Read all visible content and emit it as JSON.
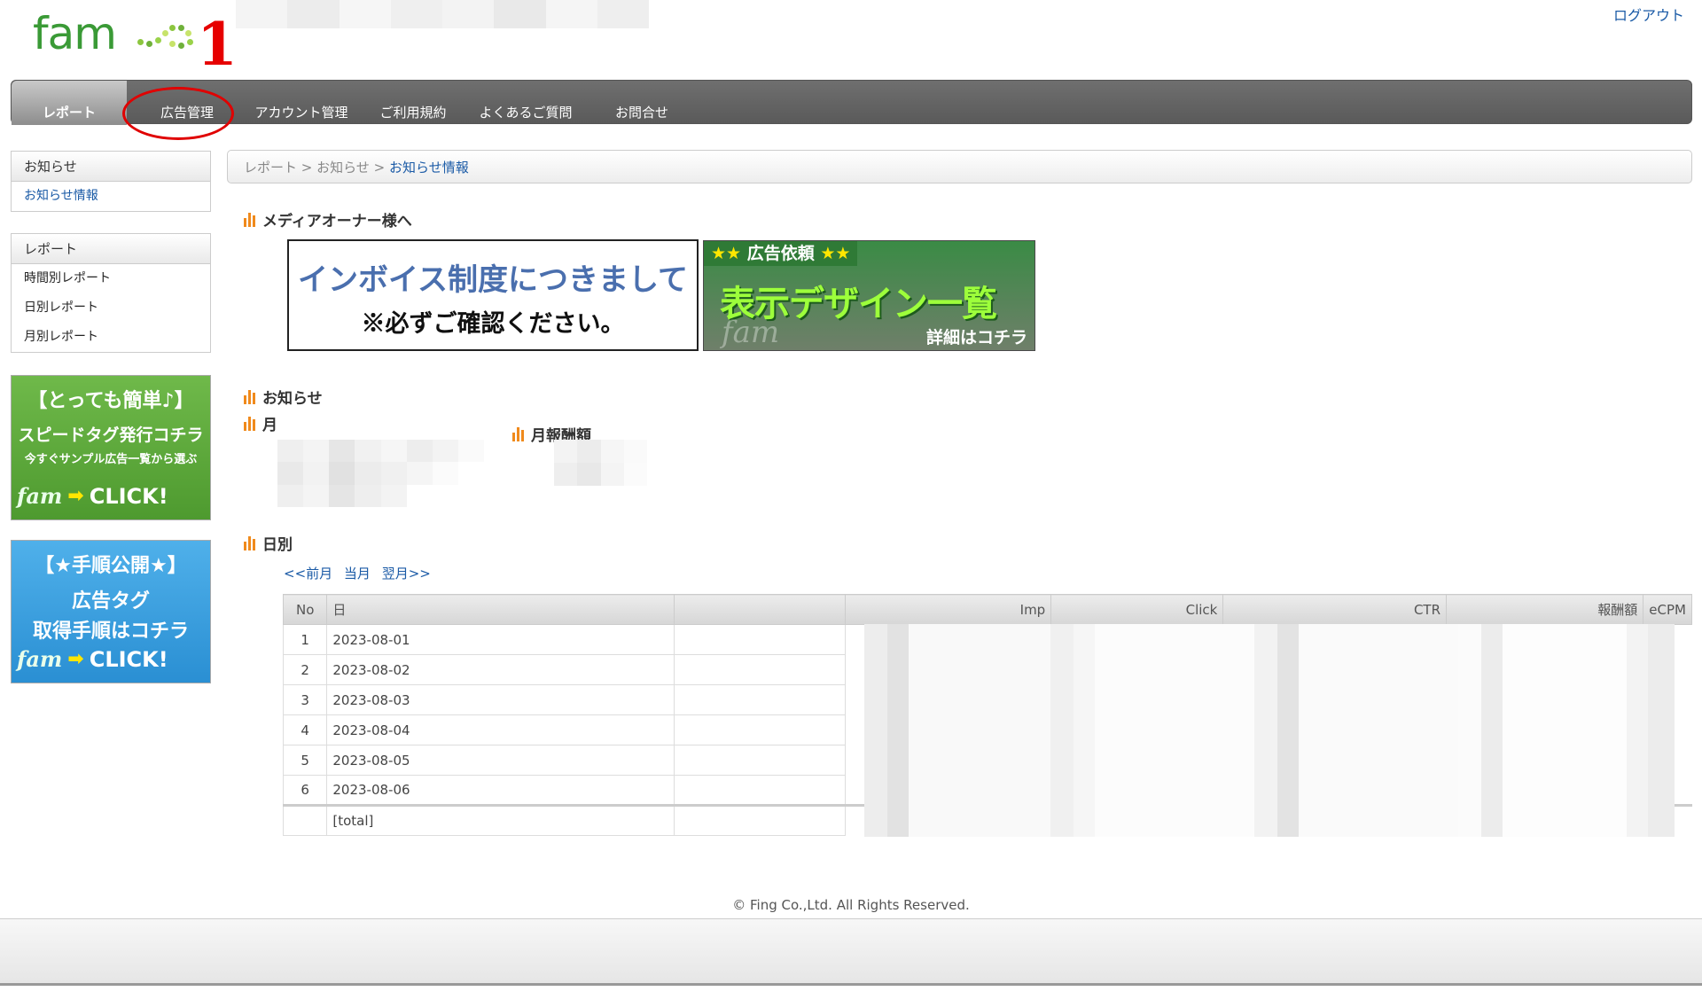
{
  "header": {
    "logo_text": "fam",
    "annotation_number": "1",
    "logout_label": "ログアウト"
  },
  "nav": {
    "items": [
      {
        "label": "レポート",
        "active": true
      },
      {
        "label": "広告管理",
        "active": false
      },
      {
        "label": "アカウント管理",
        "active": false
      },
      {
        "label": "ご利用規約",
        "active": false
      },
      {
        "label": "よくあるご質問",
        "active": false
      },
      {
        "label": "お問合せ",
        "active": false
      }
    ]
  },
  "sidebar": {
    "notice_box": {
      "title": "お知らせ",
      "items": [
        "お知らせ情報"
      ]
    },
    "report_box": {
      "title": "レポート",
      "items": [
        "時間別レポート",
        "日別レポート",
        "月別レポート"
      ]
    },
    "banner_speed": {
      "line1": "【とっても簡単♪】",
      "line2": "スピードタグ発行コチラ",
      "line3": "今すぐサンプル広告一覧から選ぶ",
      "brand": "fam",
      "click": "CLICK!"
    },
    "banner_steps": {
      "line1": "【★手順公開★】",
      "line2": "広告タグ",
      "line3": "取得手順はコチラ",
      "brand": "fam",
      "click": "CLICK!"
    }
  },
  "breadcrumb": {
    "item1": "レポート",
    "item2": "お知らせ",
    "current": "お知らせ情報",
    "sep": ">"
  },
  "sections": {
    "media_owner": "メディアオーナー様へ",
    "notice": "お知らせ",
    "month": "月",
    "monthly_reward": "月報酬額",
    "daily": "日別"
  },
  "banners": {
    "invoice_line1": "インボイス制度につきまして",
    "invoice_line2": "※必ずご確認ください。",
    "adreq_top": "広告依頼",
    "adreq_star": "★★",
    "adreq_main": "表示デザイン一覧",
    "adreq_sub": "詳細はコチラ",
    "adreq_brand": "fam"
  },
  "pager": {
    "prev": "<<前月",
    "current": "当月",
    "next": "翌月>>"
  },
  "table": {
    "headers": {
      "no": "No",
      "date": "日",
      "imp": "Imp",
      "click": "Click",
      "ctr": "CTR",
      "reward": "報酬額",
      "ecpm": "eCPM"
    },
    "rows": [
      {
        "no": "1",
        "date": "2023-08-01"
      },
      {
        "no": "2",
        "date": "2023-08-02"
      },
      {
        "no": "3",
        "date": "2023-08-03"
      },
      {
        "no": "4",
        "date": "2023-08-04"
      },
      {
        "no": "5",
        "date": "2023-08-05"
      },
      {
        "no": "6",
        "date": "2023-08-06"
      }
    ],
    "total_label": "[total]"
  },
  "footer": {
    "copyright": "© Fing Co.,Ltd. All Rights Reserved."
  },
  "colors": {
    "brand_green": "#3a9a36",
    "nav_gray": "#666666",
    "link_blue": "#1a5aa6",
    "accent_orange": "#f08a1c",
    "annotation_red": "#e60000"
  }
}
